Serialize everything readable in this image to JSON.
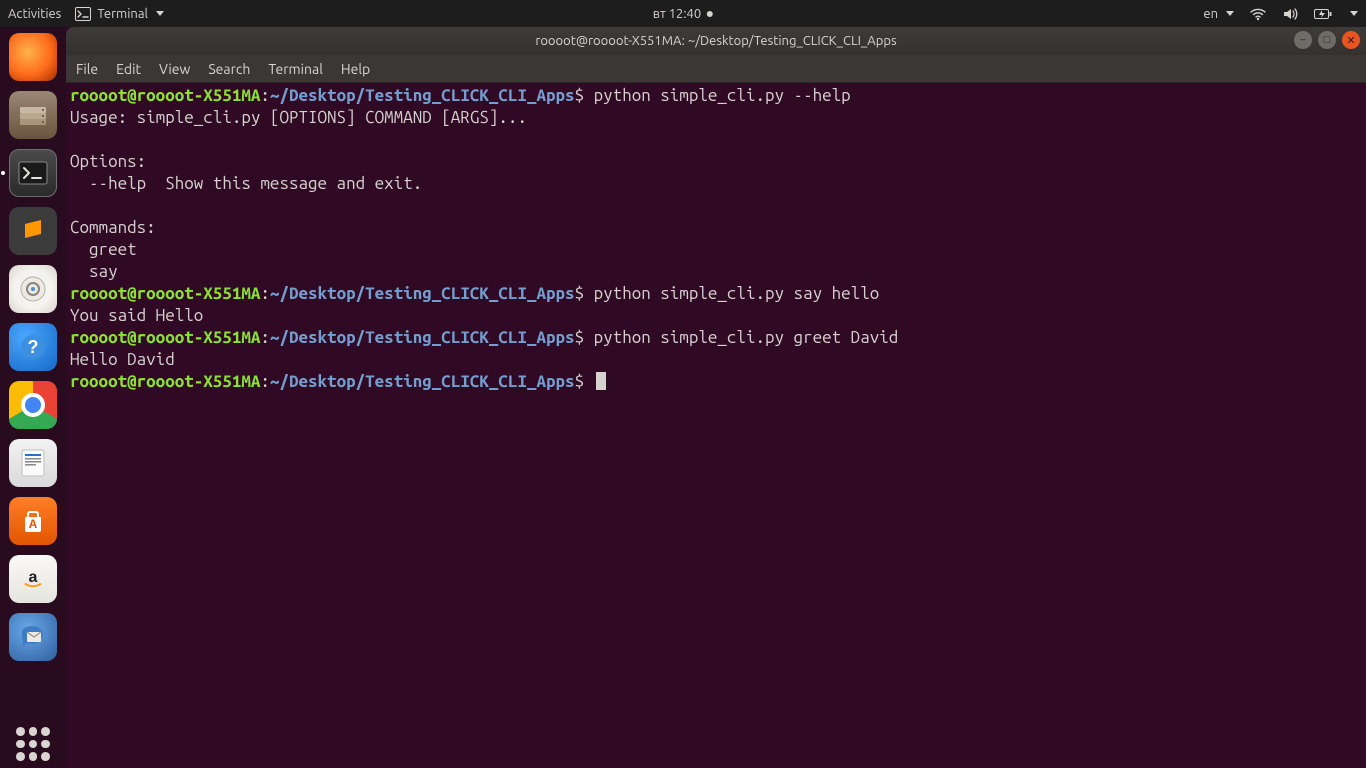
{
  "topbar": {
    "activities": "Activities",
    "appmenu": "Terminal",
    "clock": "вт 12:40",
    "lang": "en"
  },
  "launcher": {
    "items": [
      {
        "name": "firefox",
        "class": "firefox"
      },
      {
        "name": "files",
        "class": "files"
      },
      {
        "name": "terminal",
        "class": "terminal",
        "active": true
      },
      {
        "name": "sublime",
        "class": "sublime"
      },
      {
        "name": "rhythmbox",
        "class": "rhythm"
      },
      {
        "name": "help",
        "class": "helpapp"
      },
      {
        "name": "chrome",
        "class": "chrome"
      },
      {
        "name": "writer",
        "class": "writer"
      },
      {
        "name": "software",
        "class": "soft"
      },
      {
        "name": "amazon",
        "class": "amazon"
      },
      {
        "name": "thunderbird",
        "class": "thunder"
      }
    ]
  },
  "window": {
    "title": "roooot@roooot-X551MA: ~/Desktop/Testing_CLICK_CLI_Apps",
    "menus": [
      "File",
      "Edit",
      "View",
      "Search",
      "Terminal",
      "Help"
    ]
  },
  "prompt": {
    "user": "roooot@roooot-X551MA",
    "sep": ":",
    "path": "~/Desktop/Testing_CLICK_CLI_Apps",
    "sigil": "$"
  },
  "session": [
    {
      "type": "cmd",
      "text": "python simple_cli.py --help"
    },
    {
      "type": "out",
      "text": "Usage: simple_cli.py [OPTIONS] COMMAND [ARGS]..."
    },
    {
      "type": "out",
      "text": ""
    },
    {
      "type": "out",
      "text": "Options:"
    },
    {
      "type": "out",
      "text": "  --help  Show this message and exit."
    },
    {
      "type": "out",
      "text": ""
    },
    {
      "type": "out",
      "text": "Commands:"
    },
    {
      "type": "out",
      "text": "  greet"
    },
    {
      "type": "out",
      "text": "  say"
    },
    {
      "type": "cmd",
      "text": "python simple_cli.py say hello"
    },
    {
      "type": "out",
      "text": "You said Hello"
    },
    {
      "type": "cmd",
      "text": "python simple_cli.py greet David"
    },
    {
      "type": "out",
      "text": "Hello David"
    },
    {
      "type": "cmd",
      "text": "",
      "cursor": true
    }
  ]
}
